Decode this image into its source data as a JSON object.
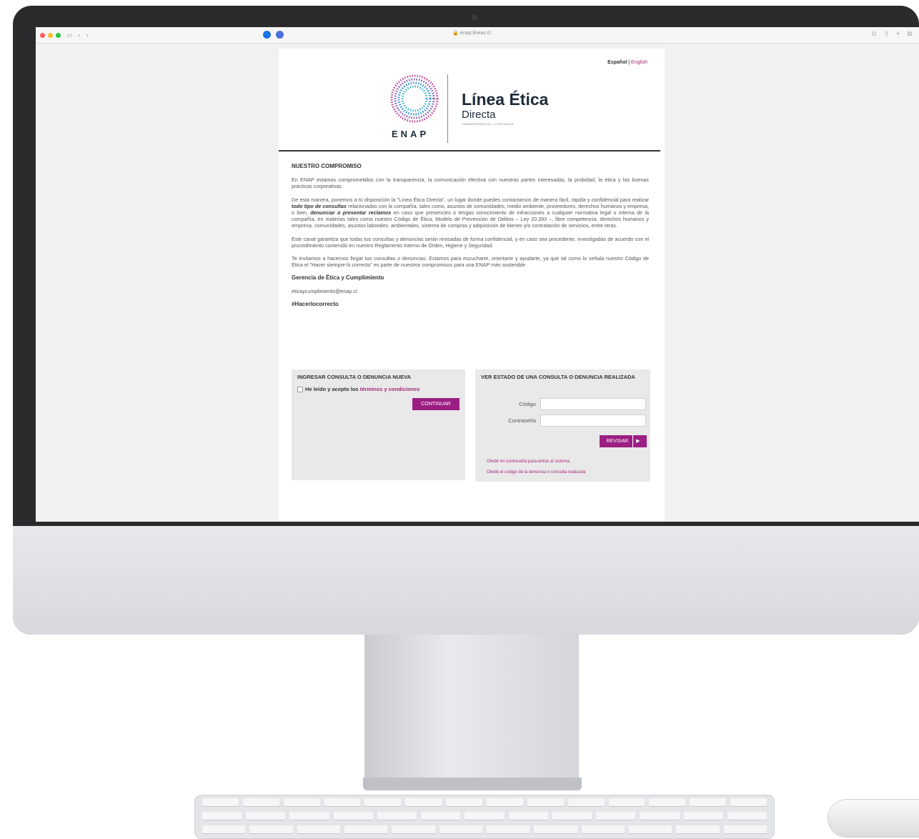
{
  "browser": {
    "url": "enap.lineas.cl"
  },
  "header": {
    "lang_es": "Español",
    "lang_sep": "|",
    "lang_en": "English",
    "logo_brand": "ENAP",
    "title": "Línea Ética",
    "subtitle": "Directa",
    "tagline": "TRANSPARENCIA • CONFIANZA"
  },
  "content": {
    "heading": "NUESTRO COMPROMISO",
    "p1": "En ENAP estamos comprometidos con la transparencia, la comunicación efectiva con nuestras partes interesadas, la probidad, la ética y las buenas prácticas corporativas.",
    "p2_a": "De esta manera, ponemos a tú disposición la \"Línea Ética Directa\", un lugar donde puedes contactarnos de manera fácil, rápida y confidencial para realizar ",
    "p2_b": "todo tipo de consultas",
    "p2_c": " relacionadas con la compañía, tales como, asuntos de comunidades, medio ambiente, proveedores, derechos humanos y empresa, o bien, ",
    "p2_d": "denunciar o presentar reclamos",
    "p2_e": " en caso que presencies o tengas conocimiento de infracciones a cualquier normativa legal o interna de la compañía, en materias tales como nuestro Código de Ética, Modelo de Prevención de Delitos – Ley 20.393 –, libre competencia, derechos humanos y empresa, comunidades, asuntos laborales, ambientales, sistema de compras y adquisición de bienes y/o contratación de servicios, entre otras.",
    "p3": "Este canal garantiza que todas tus consultas y denuncias serán revisadas de forma confidencial, y en caso sea procedente, investigadas de acuerdo con el procedimiento contenido en nuestro Reglamento Interno de Orden, Higiene y Seguridad.",
    "p4": "Te invitamos a hacernos llegar tus consultas o denuncias. Estamos para escucharte, orientarte y ayudarte, ya que tal como lo señala nuestro Código de Ética el \"Hacer siempre lo correcto\" es parte de nuestros compromisos para una ENAP más sostenible.",
    "signature": "Gerencia de Ética y Cumplimiento",
    "email": "eticaycumplimiento@enap.cl",
    "hashtag": "#Hacerlocorrecto"
  },
  "new_report": {
    "title": "INGRESAR CONSULTA O DENUNCIA NUEVA",
    "accept_prefix": "He leído y acepto los ",
    "accept_link": "términos y condiciones",
    "continue_label": "CONTINUAR"
  },
  "status_check": {
    "title": "VER ESTADO DE UNA CONSULTA O DENUNCIA REALIZADA",
    "code_label": "Código",
    "password_label": "Contraseña",
    "review_label": "REVISAR",
    "review_arrow": "▶",
    "forgot_password": "Olvidé mi contraseña para entrar al sistema",
    "forgot_code": "Olvidé el código de la denuncia o consulta realizada"
  },
  "colors": {
    "accent": "#9b1f83",
    "link": "#a4287a",
    "navy": "#1d2b3a"
  }
}
